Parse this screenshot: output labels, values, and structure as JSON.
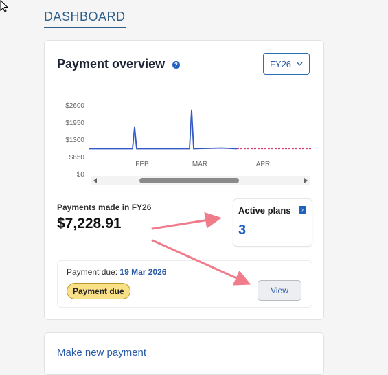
{
  "tabs": {
    "dashboard": "DASHBOARD"
  },
  "payment_overview": {
    "title": "Payment overview",
    "help_icon": "question-icon",
    "fiscal_year_select": {
      "value": "FY26"
    },
    "payments_made_label": "Payments made in FY26",
    "payments_made_value": "$7,228.91",
    "active_plans": {
      "label": "Active plans",
      "count": "3"
    },
    "payment_due": {
      "label": "Payment due:",
      "date": "19 Mar 2026",
      "badge": "Payment due",
      "view_label": "View"
    }
  },
  "next_card": {
    "link_label": "Make new payment"
  },
  "colors": {
    "accent": "#1f5fbf",
    "line": "#3558c7",
    "forecast": "#e0356e",
    "badge": "#f9df85",
    "arrow": "#f07b8a"
  },
  "chart_data": {
    "type": "line",
    "y_ticks": [
      "$2600",
      "$1950",
      "$1300",
      "$650",
      "$0"
    ],
    "x_ticks": [
      "FEB",
      "MAR",
      "APR"
    ],
    "ylim": [
      0,
      2600
    ],
    "grid": false,
    "series": [
      {
        "style": "solid",
        "points": [
          [
            "JAN-early",
            975
          ],
          [
            "FEB-early",
            975
          ],
          [
            "FEB-early",
            1800
          ],
          [
            "FEB-early",
            975
          ],
          [
            "MAR-early",
            975
          ],
          [
            "MAR-early",
            2450
          ],
          [
            "MAR-early",
            975
          ],
          [
            "MAR-late",
            1000
          ],
          [
            "APR-early",
            975
          ]
        ]
      },
      {
        "style": "dashed",
        "points": [
          [
            "APR-early",
            975
          ],
          [
            "MAY",
            975
          ]
        ]
      }
    ]
  }
}
